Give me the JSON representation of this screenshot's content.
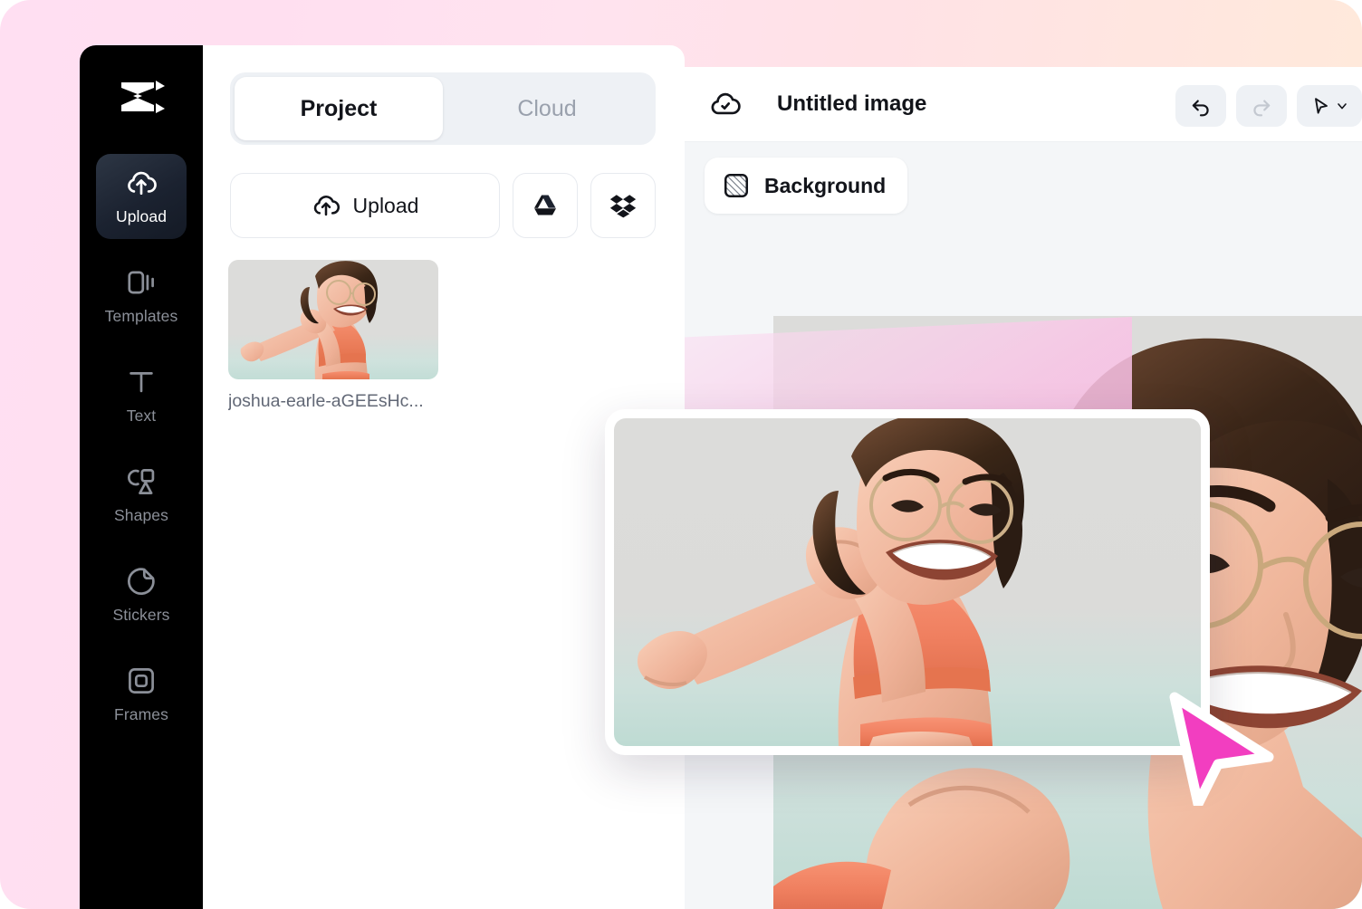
{
  "app": {
    "logo_icon": "capcut-logo-icon",
    "background_gradient": [
      "#ffdff2",
      "#ffecd9"
    ]
  },
  "sidebar": {
    "items": [
      {
        "id": "upload",
        "label": "Upload",
        "icon": "cloud-upload-icon",
        "active": true
      },
      {
        "id": "templates",
        "label": "Templates",
        "icon": "templates-icon",
        "active": false
      },
      {
        "id": "text",
        "label": "Text",
        "icon": "text-t-icon",
        "active": false
      },
      {
        "id": "shapes",
        "label": "Shapes",
        "icon": "shapes-icon",
        "active": false
      },
      {
        "id": "stickers",
        "label": "Stickers",
        "icon": "sticker-icon",
        "active": false
      },
      {
        "id": "frames",
        "label": "Frames",
        "icon": "frames-icon",
        "active": false
      }
    ]
  },
  "panel": {
    "tabs": [
      {
        "id": "project",
        "label": "Project",
        "active": true
      },
      {
        "id": "cloud",
        "label": "Cloud",
        "active": false
      }
    ],
    "upload_button": {
      "label": "Upload",
      "icon": "cloud-upload-icon"
    },
    "source_buttons": [
      {
        "id": "google-drive",
        "icon": "google-drive-icon"
      },
      {
        "id": "dropbox",
        "icon": "dropbox-icon"
      }
    ],
    "assets": [
      {
        "name": "joshua-earle-aGEEsHc...",
        "thumb": "woman-stretching-photo"
      }
    ]
  },
  "editor": {
    "save_status_icon": "cloud-check-icon",
    "title": "Untitled image",
    "toolbar": [
      {
        "id": "undo",
        "icon": "undo-icon",
        "enabled": true
      },
      {
        "id": "redo",
        "icon": "redo-icon",
        "enabled": false
      },
      {
        "id": "select",
        "icon": "cursor-arrow-icon",
        "enabled": true,
        "has_dropdown": true
      }
    ],
    "background_button": {
      "label": "Background",
      "icon": "hatched-square-icon"
    },
    "canvas_image": "woman-stretching-photo"
  },
  "drag": {
    "card_image": "woman-stretching-photo",
    "cursor_icon": "pointer-arrow-icon",
    "cursor_color": "#f23ec0",
    "beam_color": "#f7c8e8"
  }
}
